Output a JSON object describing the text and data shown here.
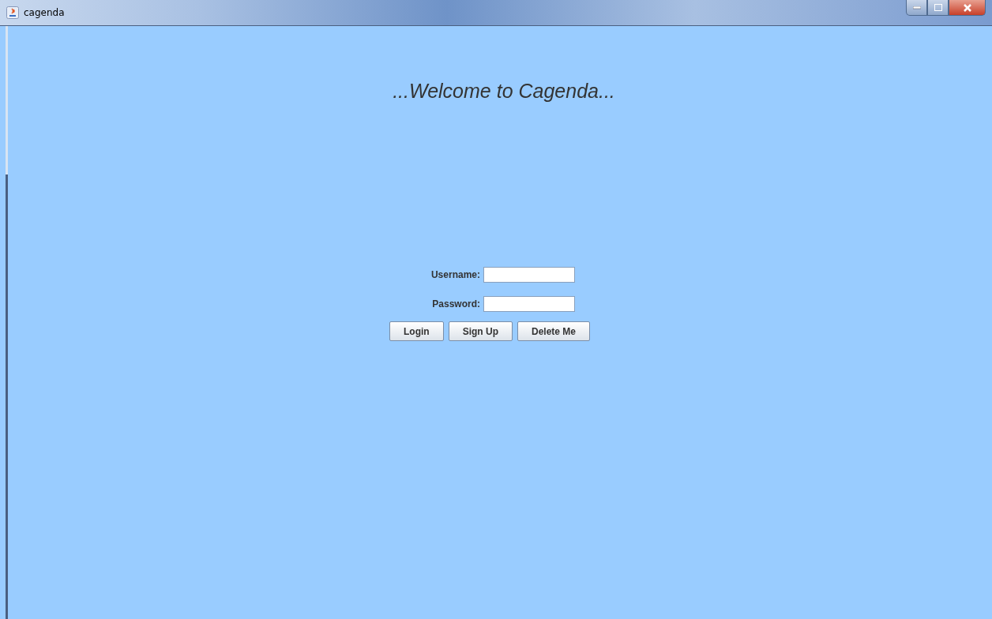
{
  "window": {
    "title": "cagenda"
  },
  "heading": "...Welcome to Cagenda...",
  "fields": [
    {
      "label": "Username:"
    },
    {
      "label": "Password:"
    }
  ],
  "buttons": [
    "Login",
    "Sign Up",
    "Delete Me"
  ]
}
